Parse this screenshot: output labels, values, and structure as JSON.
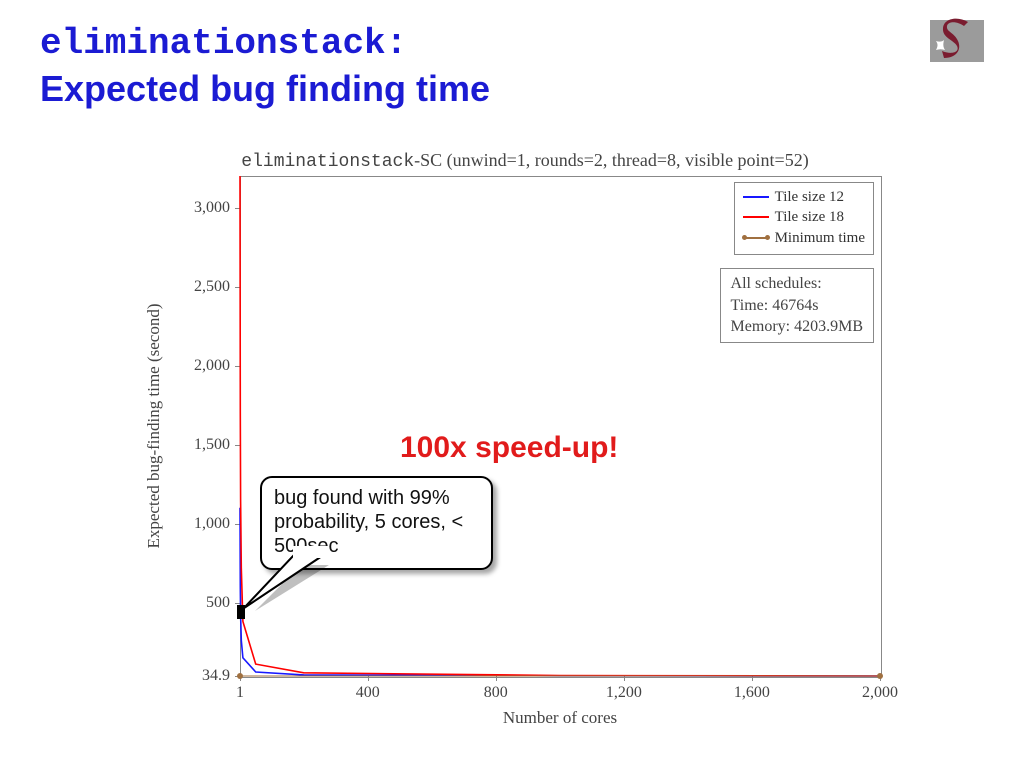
{
  "title": {
    "mono": "eliminationstack:",
    "rest": "Expected bug finding time"
  },
  "chart_data": {
    "type": "line",
    "title_mono": "eliminationstack",
    "title_rest": "-SC (unwind=1, rounds=2, thread=8, visible point=52)",
    "xlabel": "Number of cores",
    "ylabel": "Expected bug-finding time (second)",
    "xlim": [
      1,
      2000
    ],
    "ylim": [
      34.9,
      3200
    ],
    "xticks": [
      1,
      400,
      800,
      1200,
      1600,
      2000
    ],
    "yticks": [
      34.9,
      500,
      1000,
      1500,
      2000,
      2500,
      3000
    ],
    "series": [
      {
        "name": "Tile size 12",
        "color": "#1818ff",
        "x": [
          1,
          2,
          3,
          5,
          10,
          50,
          200,
          1000,
          2000
        ],
        "y": [
          1100,
          600,
          420,
          260,
          150,
          60,
          42,
          36,
          35
        ]
      },
      {
        "name": "Tile size 18",
        "color": "#ff0000",
        "x": [
          1,
          2,
          3,
          5,
          10,
          50,
          200,
          1000,
          2000
        ],
        "y": [
          3200,
          1700,
          1150,
          720,
          380,
          110,
          55,
          38,
          35
        ]
      },
      {
        "name": "Minimum time",
        "color": "#a07040",
        "marker": "dot",
        "x": [
          1,
          2000
        ],
        "y": [
          34.9,
          34.9
        ]
      }
    ],
    "info_box": {
      "lines": [
        "All schedules:",
        "Time: 46764s",
        "Memory: 4203.9MB"
      ]
    },
    "callout": "bug found with 99% probability, 5 cores, < 500sec",
    "callout_target": {
      "x": 5,
      "y": 450
    },
    "annotation": "100x speed-up!"
  }
}
